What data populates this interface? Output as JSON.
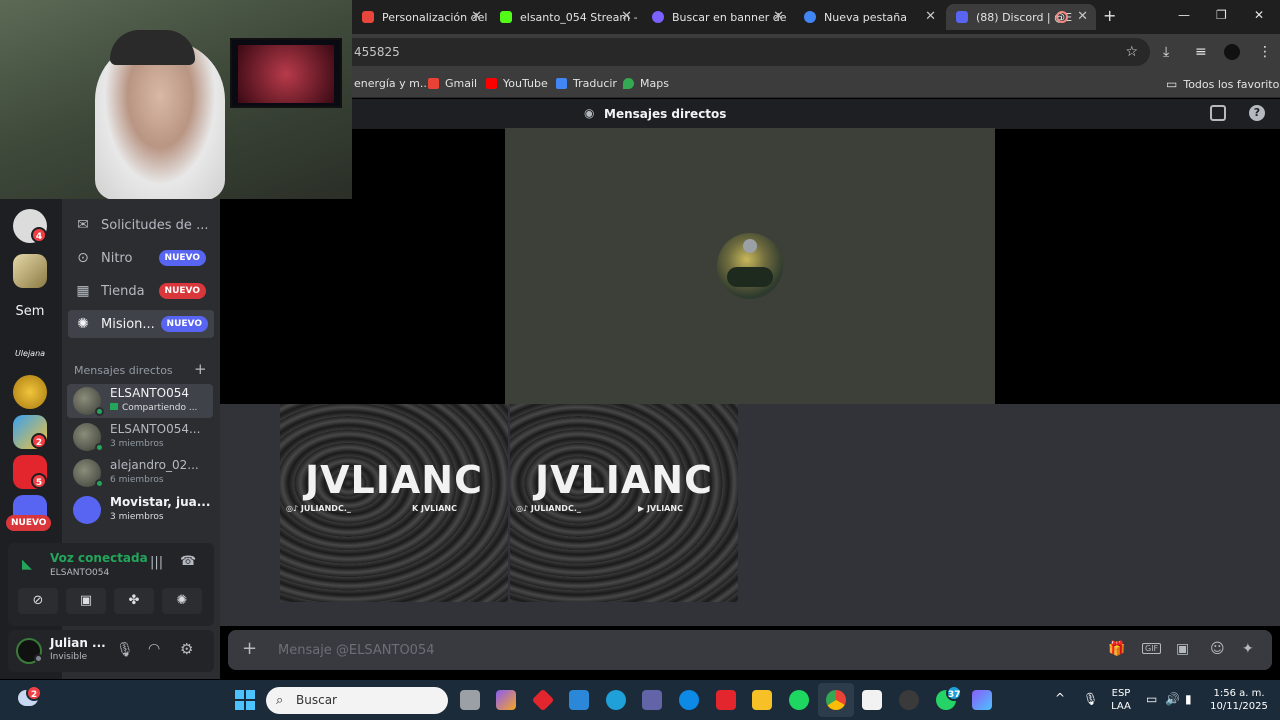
{
  "browser": {
    "tabs": [
      {
        "label": "Personalización del c",
        "color": "#e8453c"
      },
      {
        "label": "elsanto_054 Stream -",
        "color": "#53fc18"
      },
      {
        "label": "Buscar en banner de",
        "color": "#7b61ff"
      },
      {
        "label": "Nueva pestaña",
        "color": "#4285f4"
      },
      {
        "label": "(88) Discord | @E",
        "color": "#5865f2"
      }
    ],
    "new_tab": "+",
    "url": "455825",
    "bookmarks": [
      {
        "label": "energía y m...",
        "color": "#888888"
      },
      {
        "label": "Gmail",
        "color": "#ea4335"
      },
      {
        "label": "YouTube",
        "color": "#ff0000"
      },
      {
        "label": "Traducir",
        "color": "#4285f4"
      },
      {
        "label": "Maps",
        "color": "#34a853"
      }
    ],
    "all_bookmarks": "Todos los favoritos"
  },
  "discord": {
    "header_title": "Mensajes directos",
    "servers": [
      {
        "label": "",
        "badge": "4"
      },
      {
        "label": "",
        "badge": ""
      },
      {
        "label": "Sem",
        "badge": ""
      },
      {
        "label": "Ulejana",
        "badge": ""
      },
      {
        "label": "",
        "badge": ""
      },
      {
        "label": "",
        "badge": "2"
      },
      {
        "label": "",
        "badge": "5"
      },
      {
        "label": "",
        "badge": ""
      }
    ],
    "server_new_pill": "NUEVO",
    "nav": {
      "requests": "Solicitudes de ...",
      "nitro": "Nitro",
      "shop": "Tienda",
      "missions": "Mision...",
      "new_label": "NUEVO"
    },
    "dm_section": "Mensajes directos",
    "dm_add": "+",
    "dms": [
      {
        "name": "ELSANTO054",
        "sub": "Compartiendo ..."
      },
      {
        "name": "ELSANTO054...",
        "sub": "3 miembros"
      },
      {
        "name": "alejandro_02...",
        "sub": "6 miembros"
      },
      {
        "name": "Movistar, jua...",
        "sub": "3 miembros"
      }
    ],
    "voice": {
      "status": "Voz conectada",
      "channel": "ELSANTO054"
    },
    "user": {
      "name": "Julian ...",
      "status": "Invisible"
    },
    "banners": [
      {
        "title": "JVLIANC",
        "handle1": "JULIANDC._",
        "handle2": "JVLIANC"
      },
      {
        "title": "JVLIANC",
        "handle1": "JULIANDC._",
        "handle2": "JVLIANC"
      }
    ],
    "composer_placeholder": "Mensaje @ELSANTO054"
  },
  "taskbar": {
    "notification_badge": "2",
    "search_placeholder": "Buscar",
    "app_badge": "37",
    "lang_line1": "ESP",
    "lang_line2": "LAA",
    "time": "1:56 a. m.",
    "date": "10/11/2025"
  },
  "colors": {
    "discord_blurple": "#5865f2",
    "nuevo_red": "#da373c",
    "online_green": "#23a55a",
    "voice_green": "#23a55a"
  }
}
